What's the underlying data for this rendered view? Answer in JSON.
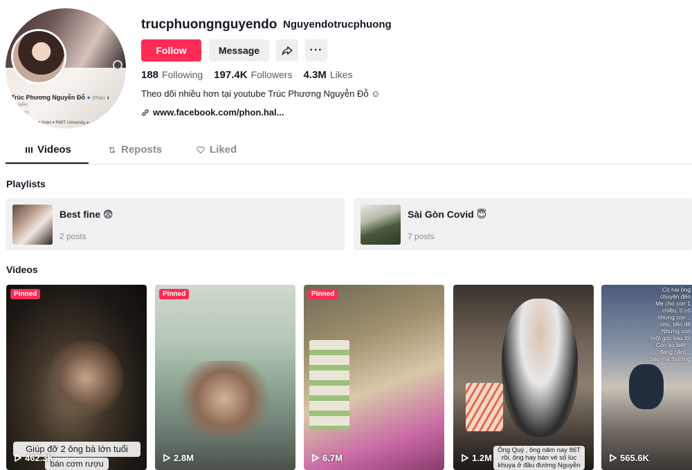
{
  "profile": {
    "username": "trucphuongnguyendo",
    "nickname": "Nguyendotrucphuong",
    "avatar_overlay": {
      "name": "Trúc Phương Nguyễn Đỗ",
      "name_suffix": "(Phôn",
      "sub": "guyễn)",
      "friends": "Friends",
      "row": "Phụt Hotel  ▾      RMIT University, ▸"
    },
    "follow_label": "Follow",
    "message_label": "Message",
    "more_label": "···",
    "stats": [
      {
        "value": "188",
        "label": "Following"
      },
      {
        "value": "197.4K",
        "label": "Followers"
      },
      {
        "value": "4.3M",
        "label": "Likes"
      }
    ],
    "bio": "Theo dõi nhiều hơn tại youtube Trúc Phương Nguyễn Đỗ ☺",
    "link": "www.facebook.com/phon.hal..."
  },
  "tabs": [
    {
      "label": "Videos",
      "icon": "grid-icon"
    },
    {
      "label": "Reposts",
      "icon": "repost-icon"
    },
    {
      "label": "Liked",
      "icon": "heart-icon"
    }
  ],
  "playlists_title": "Playlists",
  "playlists": [
    {
      "title": "Best fine 😨",
      "count": "2 posts"
    },
    {
      "title": "Sài Gòn Covid 😇",
      "count": "7 posts"
    }
  ],
  "videos_title": "Videos",
  "videos": [
    {
      "pinned": "Pinned",
      "views": "462.3K",
      "caption_top": "Giúp đỡ 2 ông bà lớn tuổi",
      "caption_bottom": "bán cơm rượu"
    },
    {
      "pinned": "Pinned",
      "views": "2.8M"
    },
    {
      "pinned": "Pinned",
      "views": "6.7M"
    },
    {
      "views": "1.2M",
      "caption_lines": [
        "Ông Quý , ông năm nay 86T",
        "rồi, ông hay bán vé số lúc",
        "khuya ở đầu đường Nguyễn"
      ]
    },
    {
      "views": "565.6K",
      "overlay_lines": [
        "Có hai ông",
        "chuyện đến",
        "Mẹ cho con 1",
        "chiều, tí có",
        "nhưng con ..",
        "cho, tiền để",
        "Nhưng con",
        "một góc sau tối",
        "Con ko biết ..",
        "đang năm ..",
        "Sao mà thương"
      ]
    }
  ]
}
